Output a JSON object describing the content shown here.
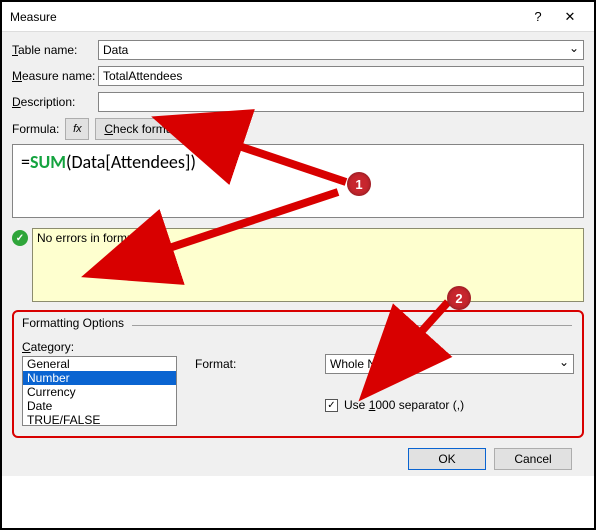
{
  "titlebar": {
    "title": "Measure"
  },
  "fields": {
    "table_label_pre": "T",
    "table_label_post": "able name:",
    "measure_label_pre": "M",
    "measure_label_post": "easure name:",
    "desc_label_pre": "D",
    "desc_label_post": "escription:",
    "table_value": "Data",
    "measure_value": "TotalAttendees",
    "desc_value": ""
  },
  "formula": {
    "label": "Formula:",
    "fx": "fx",
    "check_pre": "C",
    "check_post": "heck formula",
    "eq": "=",
    "fn": "SUM",
    "open": "(",
    "ref": "Data[Attendees]",
    "close": ")"
  },
  "status": {
    "message": "No errors in formula."
  },
  "formatting": {
    "title": "Formatting Options",
    "category_label_pre": "C",
    "category_label_post": "ategory:",
    "items": {
      "general": "General",
      "number": "Number",
      "currency": "Currency",
      "date": "Date",
      "truefalse": "TRUE/FALSE"
    },
    "format_label": "Format:",
    "format_value": "Whole Number",
    "sep_pre": "Use ",
    "sep_u": "1",
    "sep_post": "000 separator (,)",
    "sep_checked": "✓"
  },
  "buttons": {
    "ok": "OK",
    "cancel": "Cancel"
  },
  "badges": {
    "one": "1",
    "two": "2"
  }
}
